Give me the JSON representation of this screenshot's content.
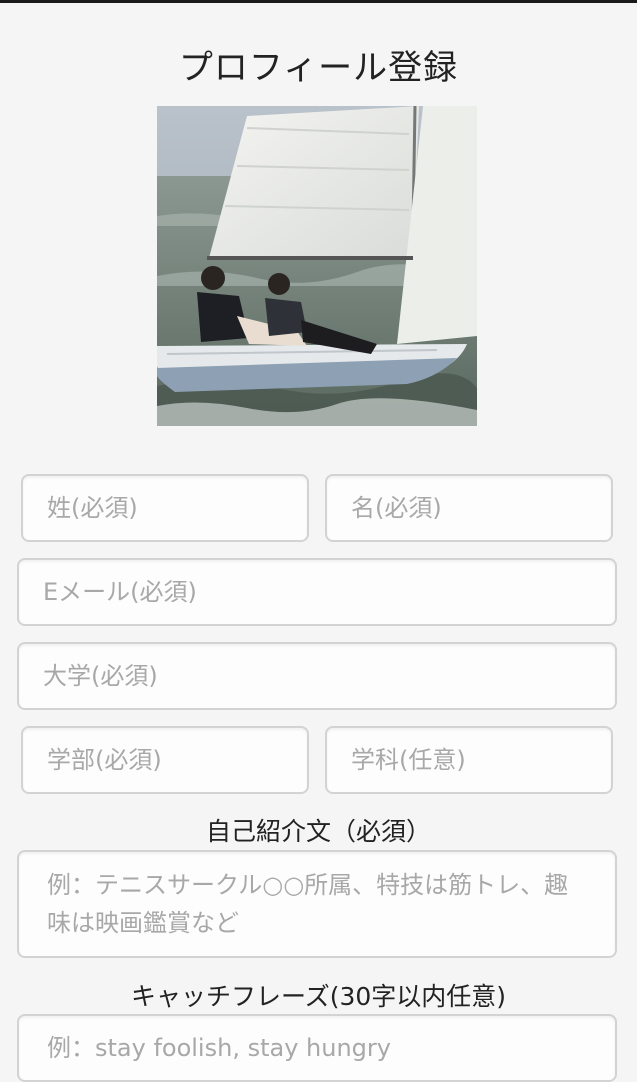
{
  "page": {
    "title": "プロフィール登録"
  },
  "form": {
    "last_name_placeholder": "姓(必須)",
    "first_name_placeholder": "名(必須)",
    "email_placeholder": "Eメール(必須)",
    "university_placeholder": "大学(必須)",
    "faculty_placeholder": "学部(必須)",
    "department_placeholder": "学科(任意)",
    "intro_label": "自己紹介文（必須）",
    "intro_placeholder": "例：テニスサークル○○所属、特技は筋トレ、趣味は映画鑑賞など",
    "catchphrase_label": "キャッチフレーズ(30字以内任意)",
    "catchphrase_placeholder": "例：stay foolish, stay hungry"
  },
  "colors": {
    "background": "#f5f5f5",
    "field_border": "#d3d3d3",
    "placeholder": "#a8a8a8",
    "text": "#222222"
  }
}
